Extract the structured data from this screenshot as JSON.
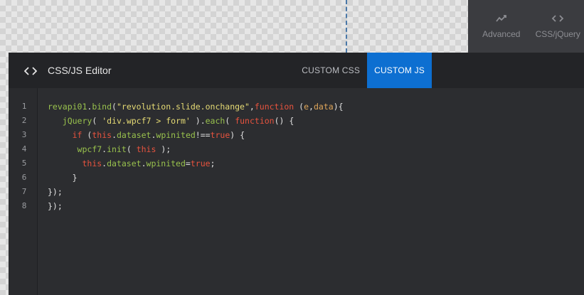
{
  "toolbar": {
    "advanced": {
      "label": "Advanced",
      "icon": "trend-line-icon"
    },
    "cssjquery": {
      "label": "CSS/jQuery",
      "icon": "code-brackets-icon"
    }
  },
  "editor": {
    "title": "CSS/JS Editor",
    "icon": "code-brackets-icon",
    "tabs": [
      {
        "label": "CUSTOM CSS",
        "active": false
      },
      {
        "label": "CUSTOM JS",
        "active": true
      }
    ],
    "line_numbers": [
      "1",
      "2",
      "3",
      "4",
      "5",
      "6",
      "7",
      "8"
    ],
    "code_lines": [
      "revapi01.bind(\"revolution.slide.onchange\",function (e,data){",
      "   jQuery( 'div.wpcf7 > form' ).each( function() {",
      "     if (this.dataset.wpinited!==true) {",
      "      wpcf7.init( this );",
      "       this.dataset.wpinited=true;",
      "     }",
      "});",
      "});"
    ]
  },
  "colors": {
    "accent": "#0d6fd1",
    "function": "#99c24d",
    "string": "#e6db74",
    "keyword": "#e8533e",
    "param": "#e0a65a"
  }
}
